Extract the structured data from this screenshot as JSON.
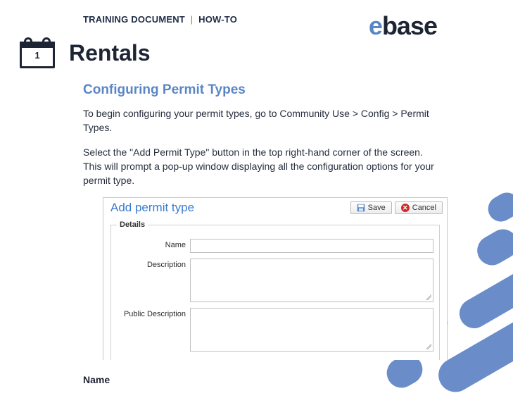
{
  "logo": {
    "prefix": "e",
    "rest": "base"
  },
  "doc_tag": {
    "left": "TRAINING DOCUMENT",
    "divider": "|",
    "right": "HOW-TO"
  },
  "calendar_icon": {
    "day": "1"
  },
  "page_title": "Rentals",
  "section_title": "Configuring Permit Types",
  "para1": "To begin configuring your permit types, go to Community Use > Config > Permit Types.",
  "para2": "Select the \"Add Permit Type\" button in the top right-hand corner of the screen. This will prompt a pop-up window displaying all the configuration options for your permit type.",
  "dialog": {
    "title": "Add permit type",
    "save_label": "Save",
    "cancel_label": "Cancel",
    "details_legend": "Details",
    "fields": {
      "name_label": "Name",
      "description_label": "Description",
      "public_description_label": "Public Description"
    }
  },
  "subhead_name": "Name"
}
